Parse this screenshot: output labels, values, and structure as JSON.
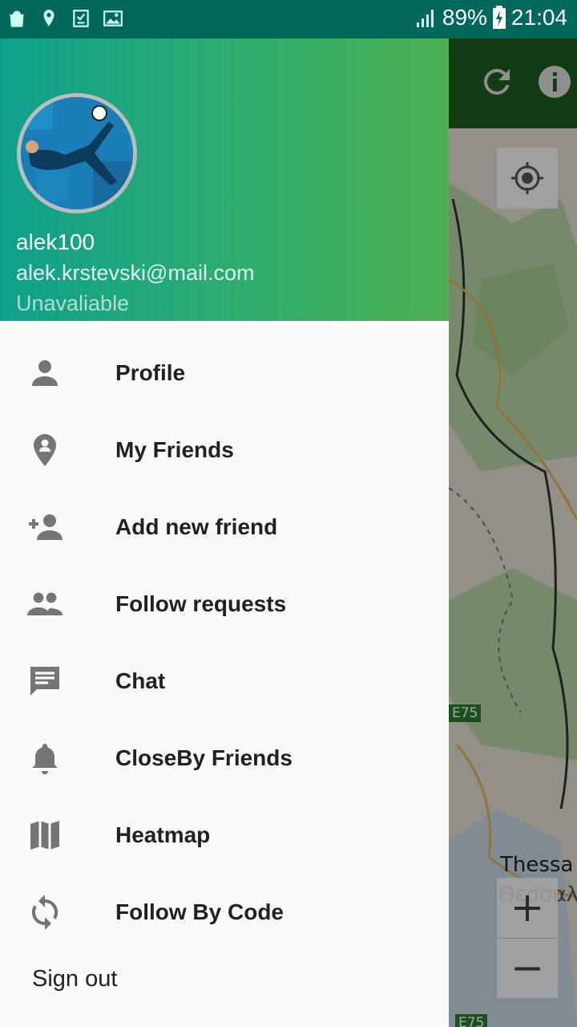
{
  "status_bar": {
    "battery": "89%",
    "time": "21:04",
    "icons": [
      "shopping-bag-icon",
      "location-pin-icon",
      "checklist-icon",
      "image-icon",
      "signal-icon",
      "battery-charging-icon"
    ]
  },
  "app_bar": {
    "actions": [
      "refresh-icon",
      "info-icon"
    ],
    "color": "#1b5e20"
  },
  "drawer": {
    "header": {
      "username": "alek100",
      "email": "alek.krstevski@mail.com",
      "status": "Unavaliable",
      "gradient": [
        "#0fa08c",
        "#4caf50"
      ]
    },
    "items": [
      {
        "label": "Profile",
        "icon": "person-icon"
      },
      {
        "label": "My Friends",
        "icon": "friend-location-icon"
      },
      {
        "label": "Add new friend",
        "icon": "person-add-icon"
      },
      {
        "label": "Follow requests",
        "icon": "people-icon"
      },
      {
        "label": "Chat",
        "icon": "chat-icon"
      },
      {
        "label": "CloseBy Friends",
        "icon": "bell-icon"
      },
      {
        "label": "Heatmap",
        "icon": "map-icon"
      },
      {
        "label": "Follow By Code",
        "icon": "sync-icon"
      }
    ],
    "sign_out": "Sign out"
  },
  "map": {
    "labels": {
      "city": "Thessa",
      "city_greek": "Θεσσαλ"
    },
    "road_badges": [
      "E75",
      "E75"
    ],
    "controls": [
      "my-location-icon",
      "zoom-in-icon",
      "zoom-out-icon"
    ]
  }
}
